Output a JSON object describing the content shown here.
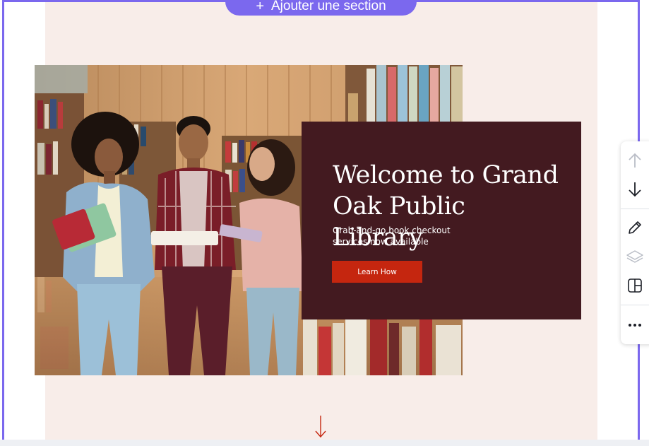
{
  "editor": {
    "add_section_label": "Ajouter une section",
    "accent_color": "#7b68ee"
  },
  "hero": {
    "title": "Welcome to Grand Oak Public Library",
    "subtitle": "Grab-and-go book checkout services now available",
    "button_label": "Learn How",
    "card_color": "#431a20",
    "button_color": "#c5260f",
    "section_bg_color": "#f8ede9"
  },
  "toolbar": {
    "items": [
      "arrow-up-icon",
      "arrow-down-icon",
      "pencil-icon",
      "layers-icon",
      "layout-icon",
      "more-icon"
    ]
  }
}
